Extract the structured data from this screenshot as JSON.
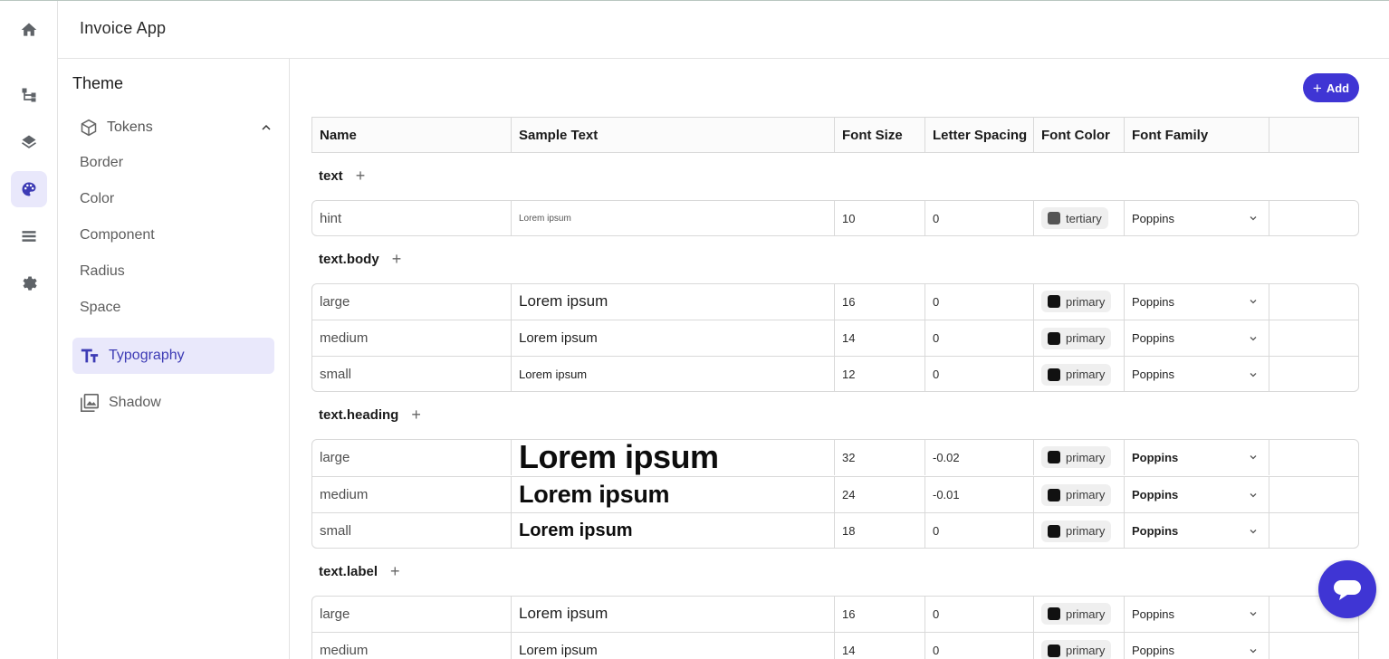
{
  "header": {
    "app_title": "Invoice App"
  },
  "rail": {
    "icons": [
      "home-icon",
      "hierarchy-icon",
      "layers-icon",
      "palette-icon",
      "list-icon",
      "gear-icon"
    ]
  },
  "panel": {
    "title": "Theme",
    "tokens_label": "Tokens",
    "token_items": [
      "Border",
      "Color",
      "Component",
      "Radius",
      "Space"
    ],
    "typography_label": "Typography",
    "shadow_label": "Shadow"
  },
  "toolbar": {
    "add_label": "Add"
  },
  "table": {
    "columns": [
      "Name",
      "Sample Text",
      "Font Size",
      "Letter Spacing",
      "Font Color",
      "Font Family",
      ""
    ],
    "groups": [
      {
        "label": "text",
        "rows": [
          {
            "name": "hint",
            "sample": "Lorem ipsum",
            "size": "10",
            "spacing": "0",
            "color": "tertiary",
            "family": "Poppins"
          }
        ]
      },
      {
        "label": "text.body",
        "rows": [
          {
            "name": "large",
            "sample": "Lorem ipsum",
            "size": "16",
            "spacing": "0",
            "color": "primary",
            "family": "Poppins"
          },
          {
            "name": "medium",
            "sample": "Lorem ipsum",
            "size": "14",
            "spacing": "0",
            "color": "primary",
            "family": "Poppins"
          },
          {
            "name": "small",
            "sample": "Lorem ipsum",
            "size": "12",
            "spacing": "0",
            "color": "primary",
            "family": "Poppins"
          }
        ]
      },
      {
        "label": "text.heading",
        "rows": [
          {
            "name": "large",
            "sample": "Lorem ipsum",
            "size": "32",
            "spacing": "-0.02",
            "color": "primary",
            "family": "Poppins"
          },
          {
            "name": "medium",
            "sample": "Lorem ipsum",
            "size": "24",
            "spacing": "-0.01",
            "color": "primary",
            "family": "Poppins"
          },
          {
            "name": "small",
            "sample": "Lorem ipsum",
            "size": "18",
            "spacing": "0",
            "color": "primary",
            "family": "Poppins"
          }
        ]
      },
      {
        "label": "text.label",
        "rows": [
          {
            "name": "large",
            "sample": "Lorem ipsum",
            "size": "16",
            "spacing": "0",
            "color": "primary",
            "family": "Poppins"
          },
          {
            "name": "medium",
            "sample": "Lorem ipsum",
            "size": "14",
            "spacing": "0",
            "color": "primary",
            "family": "Poppins"
          }
        ]
      }
    ]
  },
  "colors": {
    "accent": "#3f35d4",
    "active_bg": "#e9e8fb",
    "primary_swatch": "#111111",
    "tertiary_swatch": "#555555"
  }
}
